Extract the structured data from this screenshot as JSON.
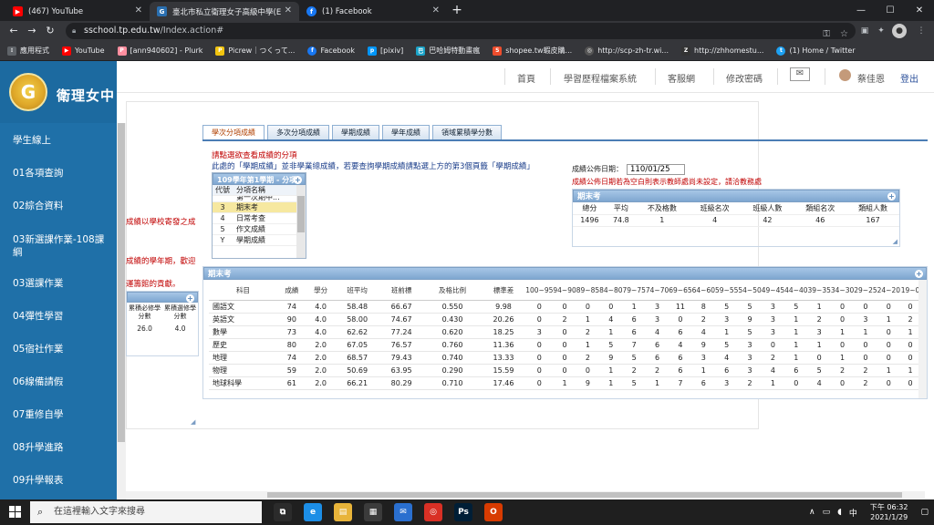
{
  "browser": {
    "tabs": [
      {
        "title": "(467) YouTube",
        "favicon": "youtube-icon",
        "color": "#ff0000"
      },
      {
        "title": "臺北市私立衛理女子高級中學(E",
        "favicon": "school-icon",
        "color": "#2a6fb0"
      },
      {
        "title": "(1) Facebook",
        "favicon": "facebook-icon",
        "color": "#1877f2"
      }
    ],
    "url_host": "sschool.tp.edu.tw",
    "url_path": "/Index.action#",
    "bookmarks": [
      {
        "label": "應用程式",
        "icon": "apps-icon",
        "color": "#5f6368"
      },
      {
        "label": "YouTube",
        "icon": "youtube-icon",
        "color": "#ff0000"
      },
      {
        "label": "[ann940602] - Plurk",
        "icon": "plurk-icon",
        "color": "#ff8fa0"
      },
      {
        "label": "Picrew｜つくって...",
        "icon": "picrew-icon",
        "color": "#f1c40f"
      },
      {
        "label": "Facebook",
        "icon": "facebook-icon",
        "color": "#1877f2"
      },
      {
        "label": "[pixiv]",
        "icon": "pixiv-icon",
        "color": "#0096fa"
      },
      {
        "label": "巴哈姆特動畫瘋",
        "icon": "bahamut-icon",
        "color": "#1aa3c8"
      },
      {
        "label": "shopee.tw蝦皮購...",
        "icon": "shopee-icon",
        "color": "#ee4d2d"
      },
      {
        "label": "http://scp-zh-tr.wi...",
        "icon": "scp-icon",
        "color": "#555555"
      },
      {
        "label": "http://zhhomestu...",
        "icon": "zhh-icon",
        "color": "#333333"
      },
      {
        "label": "(1) Home / Twitter",
        "icon": "twitter-icon",
        "color": "#1da1f2"
      }
    ]
  },
  "site": {
    "school_name": "衛理女中",
    "emblem_letter": "G",
    "topnav": [
      "首頁",
      "學習歷程檔案系統",
      "客服網",
      "修改密碼"
    ],
    "user_name": "蔡佳恩",
    "logout": "登出",
    "sidebar": [
      "學生線上",
      "01各項查詢",
      "02綜合資料",
      "03新選課作業-108課綱",
      "03選課作業",
      "04彈性學習",
      "05宿社作業",
      "06線備請假",
      "07重修自學",
      "08升學進路",
      "09升學報表"
    ]
  },
  "left_fragments": [
    "成績以學校寄發之成",
    "成績的學年期，歡迎",
    "運籌館的貢獻。"
  ],
  "left_panel": {
    "headers": [
      "累積必修學分數",
      "累積選修學分數"
    ],
    "values": [
      "26.0",
      "4.0"
    ],
    "lead": "0"
  },
  "content": {
    "tabs": [
      "學次分項成績",
      "多次分項成績",
      "學期成績",
      "學年成績",
      "領域累積學分數"
    ],
    "instruction_line1": "請點選欲查看成績的分項",
    "instruction_line2a": "此處的「學期成績」並非學業總成績，若要查詢學期成績請點選上方的第3個頁籤「學期成績」",
    "select_header": "109學年第1學期 - 分項",
    "select_cols": [
      "代號",
      "分項名稱"
    ],
    "select_rows": [
      {
        "code": "",
        "name": "第一次期中..."
      },
      {
        "code": "3",
        "name": "期末考",
        "selected": true
      },
      {
        "code": "4",
        "name": "日常考查"
      },
      {
        "code": "5",
        "name": "作文成績"
      },
      {
        "code": "Y",
        "name": "學期成績"
      }
    ],
    "date_label": "成績公佈日期：",
    "date_value": "110/01/25",
    "date_note": "成績公佈日期若為空白則表示教師處尚未設定，請洽教務處",
    "summary_title": "期末考",
    "summary_headers": [
      "總分",
      "平均",
      "不及格數",
      "班級名次",
      "班級人數",
      "類組名次",
      "類組人數"
    ],
    "summary_values": [
      "1496",
      "74.8",
      "1",
      "4",
      "42",
      "46",
      "167"
    ],
    "detail_title": "期末考",
    "detail_headers": [
      "科目",
      "成績",
      "學分",
      "班平均",
      "班前標",
      "及格比例",
      "標準差",
      "100~95",
      "94~90",
      "89~85",
      "84~80",
      "79~75",
      "74~70",
      "69~65",
      "64~60",
      "59~55",
      "54~50",
      "49~45",
      "44~40",
      "39~35",
      "34~30",
      "29~25",
      "24~20",
      "19~0"
    ],
    "detail_rows": [
      [
        "國語文",
        "74",
        "4.0",
        "58.48",
        "66.67",
        "0.550",
        "9.98",
        "0",
        "0",
        "0",
        "0",
        "1",
        "3",
        "11",
        "8",
        "5",
        "5",
        "3",
        "5",
        "1",
        "0",
        "0",
        "0",
        "0"
      ],
      [
        "英語文",
        "90",
        "4.0",
        "58.00",
        "74.67",
        "0.430",
        "20.26",
        "0",
        "2",
        "1",
        "4",
        "6",
        "3",
        "0",
        "2",
        "3",
        "9",
        "3",
        "1",
        "2",
        "0",
        "3",
        "1",
        "2"
      ],
      [
        "數學",
        "73",
        "4.0",
        "62.62",
        "77.24",
        "0.620",
        "18.25",
        "3",
        "0",
        "2",
        "1",
        "6",
        "4",
        "6",
        "4",
        "1",
        "5",
        "3",
        "1",
        "3",
        "1",
        "1",
        "0",
        "1"
      ],
      [
        "歷史",
        "80",
        "2.0",
        "67.05",
        "76.57",
        "0.760",
        "11.36",
        "0",
        "0",
        "1",
        "5",
        "7",
        "6",
        "4",
        "9",
        "5",
        "3",
        "0",
        "1",
        "1",
        "0",
        "0",
        "0",
        "0"
      ],
      [
        "地理",
        "74",
        "2.0",
        "68.57",
        "79.43",
        "0.740",
        "13.33",
        "0",
        "0",
        "2",
        "9",
        "5",
        "6",
        "6",
        "3",
        "4",
        "3",
        "2",
        "1",
        "0",
        "1",
        "0",
        "0",
        "0"
      ],
      [
        "物理",
        "59",
        "2.0",
        "50.69",
        "63.95",
        "0.290",
        "15.59",
        "0",
        "0",
        "0",
        "1",
        "2",
        "2",
        "6",
        "1",
        "6",
        "3",
        "4",
        "6",
        "5",
        "2",
        "2",
        "1",
        "1"
      ],
      [
        "地球科學",
        "61",
        "2.0",
        "66.21",
        "80.29",
        "0.710",
        "17.46",
        "0",
        "1",
        "9",
        "1",
        "5",
        "1",
        "7",
        "6",
        "3",
        "2",
        "1",
        "0",
        "4",
        "0",
        "2",
        "0",
        "0"
      ]
    ]
  },
  "taskbar": {
    "search_placeholder": "在這裡輸入文字來搜尋",
    "apps": [
      {
        "icon": "task-view-icon",
        "color": "#2b2b2b",
        "glyph": "⧉"
      },
      {
        "icon": "edge-icon",
        "color": "#1c8ee6",
        "glyph": "e"
      },
      {
        "icon": "file-explorer-icon",
        "color": "#e8b43a",
        "glyph": "▤"
      },
      {
        "icon": "store-icon",
        "color": "#3b3b3b",
        "glyph": "▦"
      },
      {
        "icon": "mail-icon",
        "color": "#2a6fcf",
        "glyph": "✉"
      },
      {
        "icon": "chrome-icon",
        "color": "#d93025",
        "glyph": "◎"
      },
      {
        "icon": "photoshop-icon",
        "color": "#001e36",
        "glyph": "Ps"
      },
      {
        "icon": "office-icon",
        "color": "#d83b01",
        "glyph": "O"
      }
    ],
    "ime": "中",
    "time": "下午 06:32",
    "date": "2021/1/29"
  }
}
